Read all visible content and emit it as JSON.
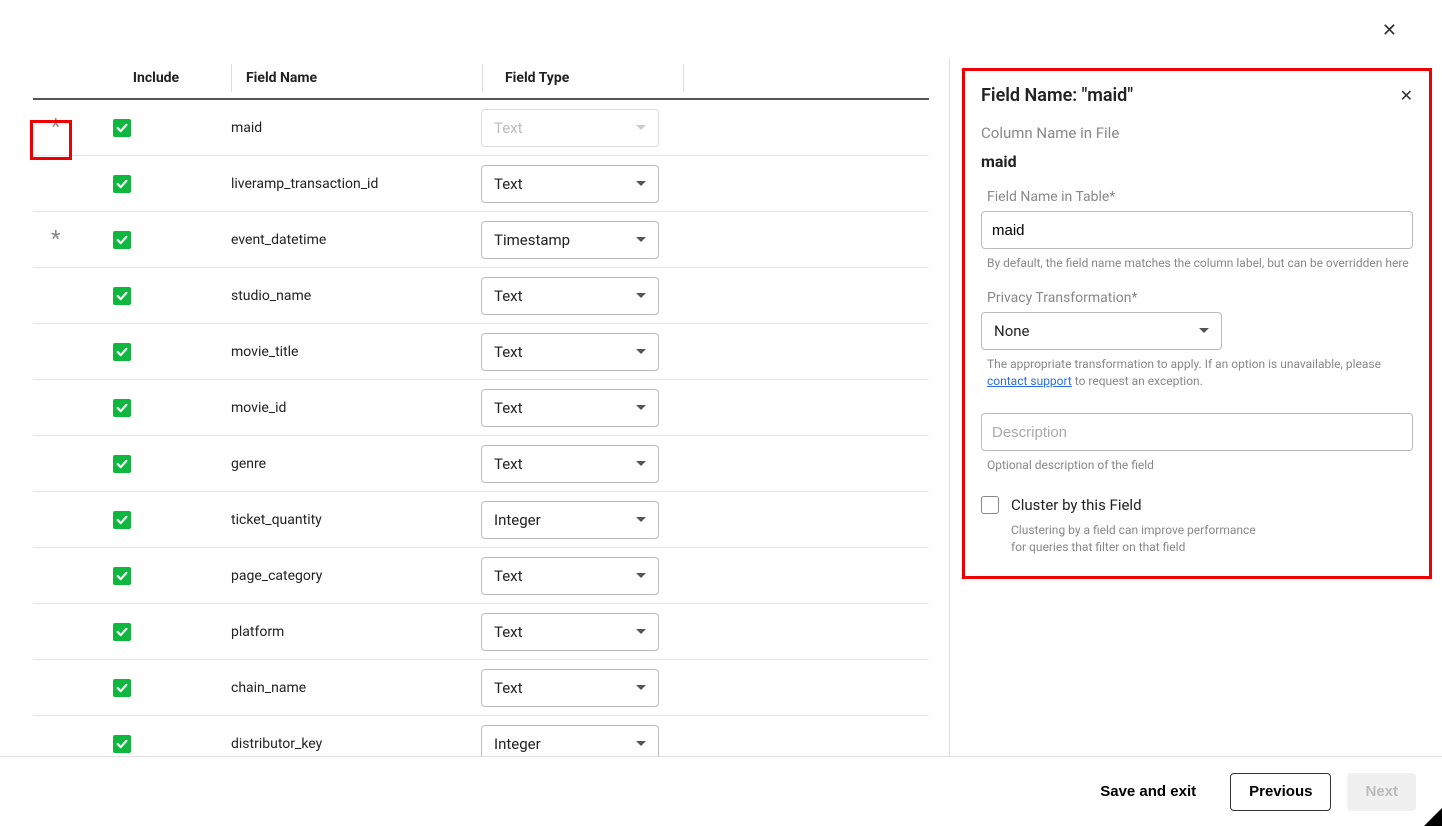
{
  "header": {
    "col_include": "Include",
    "col_fname": "Field Name",
    "col_ftype": "Field Type"
  },
  "rows": [
    {
      "marker": "*",
      "name": "maid",
      "type": "Text",
      "disabled": true
    },
    {
      "marker": "",
      "name": "liveramp_transaction_id",
      "type": "Text",
      "disabled": false
    },
    {
      "marker": "*",
      "name": "event_datetime",
      "type": "Timestamp",
      "disabled": false
    },
    {
      "marker": "",
      "name": "studio_name",
      "type": "Text",
      "disabled": false
    },
    {
      "marker": "",
      "name": "movie_title",
      "type": "Text",
      "disabled": false
    },
    {
      "marker": "",
      "name": "movie_id",
      "type": "Text",
      "disabled": false
    },
    {
      "marker": "",
      "name": "genre",
      "type": "Text",
      "disabled": false
    },
    {
      "marker": "",
      "name": "ticket_quantity",
      "type": "Integer",
      "disabled": false
    },
    {
      "marker": "",
      "name": "page_category",
      "type": "Text",
      "disabled": false
    },
    {
      "marker": "",
      "name": "platform",
      "type": "Text",
      "disabled": false
    },
    {
      "marker": "",
      "name": "chain_name",
      "type": "Text",
      "disabled": false
    },
    {
      "marker": "",
      "name": "distributor_key",
      "type": "Integer",
      "disabled": false
    }
  ],
  "panel": {
    "title": "Field Name: \"maid\"",
    "colname_label": "Column Name in File",
    "colname_value": "maid",
    "fname_label": "Field Name in Table",
    "fname_req": "*",
    "fname_value": "maid",
    "fname_help": "By default, the field name matches the column label, but can be overridden here",
    "privacy_label": "Privacy Transformation",
    "privacy_req": "*",
    "privacy_value": "None",
    "privacy_help_pre": "The appropriate transformation to apply. If an option is unavailable, please ",
    "privacy_link": "contact support",
    "privacy_help_post": " to request an exception.",
    "desc_placeholder": "Description",
    "desc_help": "Optional description of the field",
    "cluster_label": "Cluster by this Field",
    "cluster_help1": "Clustering by a field can improve performance",
    "cluster_help2": "for queries that filter on that field"
  },
  "footer": {
    "save": "Save and exit",
    "prev": "Previous",
    "next": "Next"
  }
}
